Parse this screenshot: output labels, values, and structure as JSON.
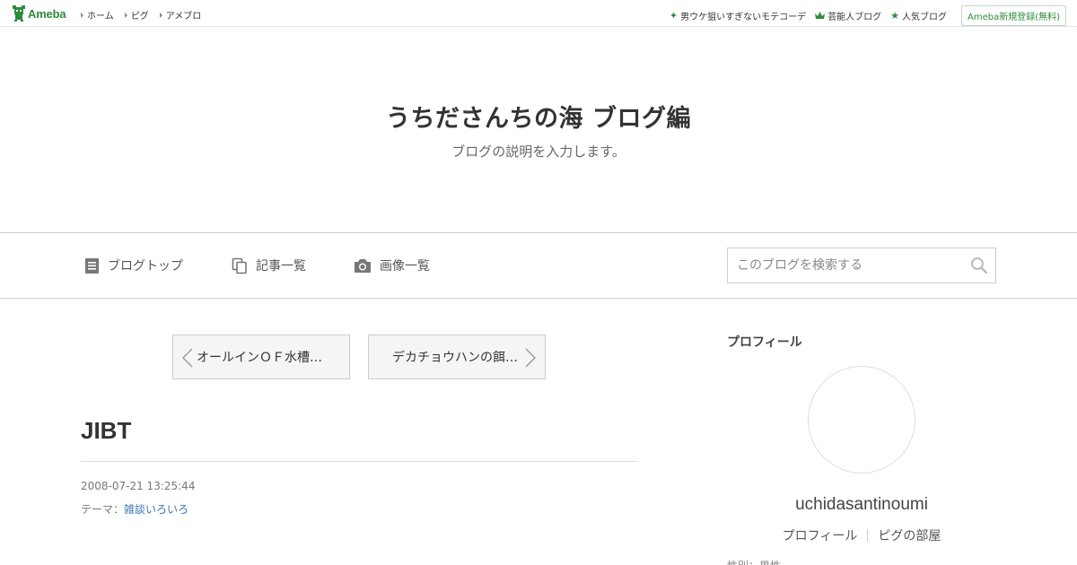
{
  "topbar": {
    "logo_text": "Ameba",
    "nav": [
      {
        "label": "ホーム"
      },
      {
        "label": "ピグ"
      },
      {
        "label": "アメブロ"
      }
    ],
    "right_links": [
      {
        "icon": "sparkle-icon",
        "label": "男ウケ狙いすぎないモテコーデ"
      },
      {
        "icon": "crown-icon",
        "label": "芸能人ブログ"
      },
      {
        "icon": "star-icon",
        "label": "人気ブログ"
      }
    ],
    "register_label": "Ameba新規登録(無料)",
    "accent_color": "#2d8c3c"
  },
  "header": {
    "title": "うちださんちの海 ブログ編",
    "description": "ブログの説明を入力します。"
  },
  "blognav": {
    "items": [
      {
        "icon": "document-icon",
        "label": "ブログトップ"
      },
      {
        "icon": "copy-icon",
        "label": "記事一覧"
      },
      {
        "icon": "camera-icon",
        "label": "画像一覧"
      }
    ],
    "search_placeholder": "このブログを検索する"
  },
  "entry": {
    "prev_label": "オールインＯＦ水槽…",
    "next_label": "デカチョウハンの餌…",
    "title": "JIBT",
    "date": "2008-07-21 13:25:44",
    "theme_prefix": "テーマ：",
    "theme": "雑談いろいろ",
    "link_color": "#3a75b0"
  },
  "sidebar": {
    "heading": "プロフィール",
    "nickname": "uchidasantinoumi",
    "links": [
      "プロフィール",
      "ピグの部屋"
    ],
    "cutoff_text": "性別：男性"
  }
}
